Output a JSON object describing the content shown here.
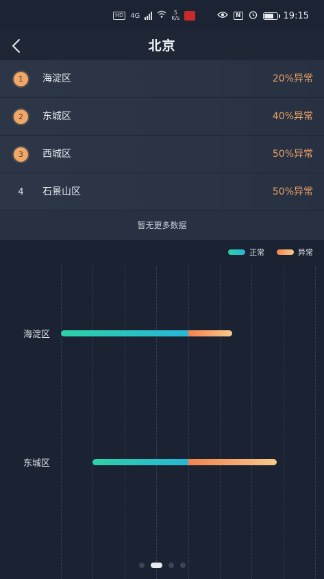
{
  "status_bar": {
    "hd": "HD",
    "net": "4G",
    "rate_num": "5",
    "rate_unit": "K/s",
    "nfc": "N",
    "time": "19:15",
    "battery_level": 0.8
  },
  "header": {
    "title": "北京"
  },
  "list": {
    "items": [
      {
        "rank": "1",
        "name": "海淀区",
        "value": "20%异常"
      },
      {
        "rank": "2",
        "name": "东城区",
        "value": "40%异常"
      },
      {
        "rank": "3",
        "name": "西城区",
        "value": "50%异常"
      },
      {
        "rank": "4",
        "name": "石景山区",
        "value": "50%异常"
      }
    ],
    "no_more": "暂无更多数据"
  },
  "colors": {
    "normal_start": "#2ed1a6",
    "normal_end": "#28b6d9",
    "abnormal_start": "#f2834e",
    "abnormal_end": "#f9c98a",
    "accent_orange": "#e9a265"
  },
  "chart_data": {
    "type": "bar",
    "orientation": "horizontal",
    "categories": [
      "海淀区",
      "东城区"
    ],
    "series": [
      {
        "name": "正常",
        "values": [
          40,
          30
        ]
      },
      {
        "name": "异常",
        "values": [
          14,
          28
        ]
      }
    ],
    "offsets": [
      0,
      10
    ],
    "xlim": [
      0,
      80
    ],
    "legend_position": "top-right",
    "grid": true
  },
  "pager": {
    "count": 4,
    "active": 1
  }
}
